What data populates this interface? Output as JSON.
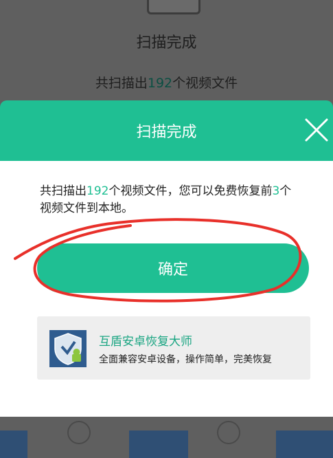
{
  "background": {
    "title": "扫描完成",
    "summary_prefix": "共扫描出",
    "summary_count": "192",
    "summary_suffix": "个视频文件"
  },
  "dialog": {
    "title": "扫描完成",
    "message": {
      "part1": "共扫描出",
      "count": "192",
      "part2": "个视频文件，您可以免费恢复前",
      "free_count": "3",
      "part3": "个视频文件到本地。"
    },
    "confirm_label": "确定",
    "promo": {
      "name": "互盾安卓恢复大师",
      "description": "全面兼容安卓设备，操作简单，完美恢复"
    }
  },
  "colors": {
    "accent": "#1fbf93",
    "overlay": "#5f5f5f",
    "annotation_red": "#e8302a"
  },
  "icons": {
    "close": "close-icon",
    "promo_logo": "shield-android-logo"
  }
}
